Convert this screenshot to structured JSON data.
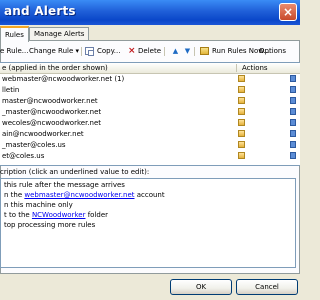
{
  "window": {
    "title": "and Alerts",
    "close_glyph": "×"
  },
  "tabs": [
    {
      "label": "Rules",
      "active": true
    },
    {
      "label": "Manage Alerts",
      "active": false
    }
  ],
  "toolbar": {
    "new_rule": "e Rule...",
    "change_rule": "Change Rule",
    "change_rule_arrow": "▾",
    "copy": "Copy...",
    "delete": "Delete",
    "run_rules": "Run Rules Now...",
    "options": "Options",
    "icons": [
      "copy-icon",
      "delete-icon",
      "move-up-icon",
      "move-down-icon",
      "run-rules-icon"
    ]
  },
  "list": {
    "columns": [
      "e (applied in the order shown)",
      "Actions"
    ],
    "rows": [
      "webmaster@ncwoodworker.net (1)",
      "lletin",
      "master@ncwoodworker.net",
      "_master@ncwoodworker.net",
      "wecoles@ncwoodworker.net",
      "ain@ncwoodworker.net",
      "_master@coles.us",
      "et@coles.us"
    ]
  },
  "description": {
    "label": "cription (click an underlined value to edit):",
    "lines": [
      {
        "pre": "this rule after the message arrives",
        "link": "",
        "post": ""
      },
      {
        "pre": "n the ",
        "link": "webmaster@ncwoodworker.net",
        "post": " account"
      },
      {
        "pre": "n this machine only",
        "link": "",
        "post": ""
      },
      {
        "pre": "t to the ",
        "link": "NCWoodworker",
        "post": " folder"
      },
      {
        "pre": "top processing more rules",
        "link": "",
        "post": ""
      }
    ]
  },
  "buttons": {
    "ok": "OK",
    "cancel": "Cancel"
  },
  "colors": {
    "title_bar": "#0a47c9",
    "link": "#0000ee",
    "tab_accent": "#f5a623"
  }
}
